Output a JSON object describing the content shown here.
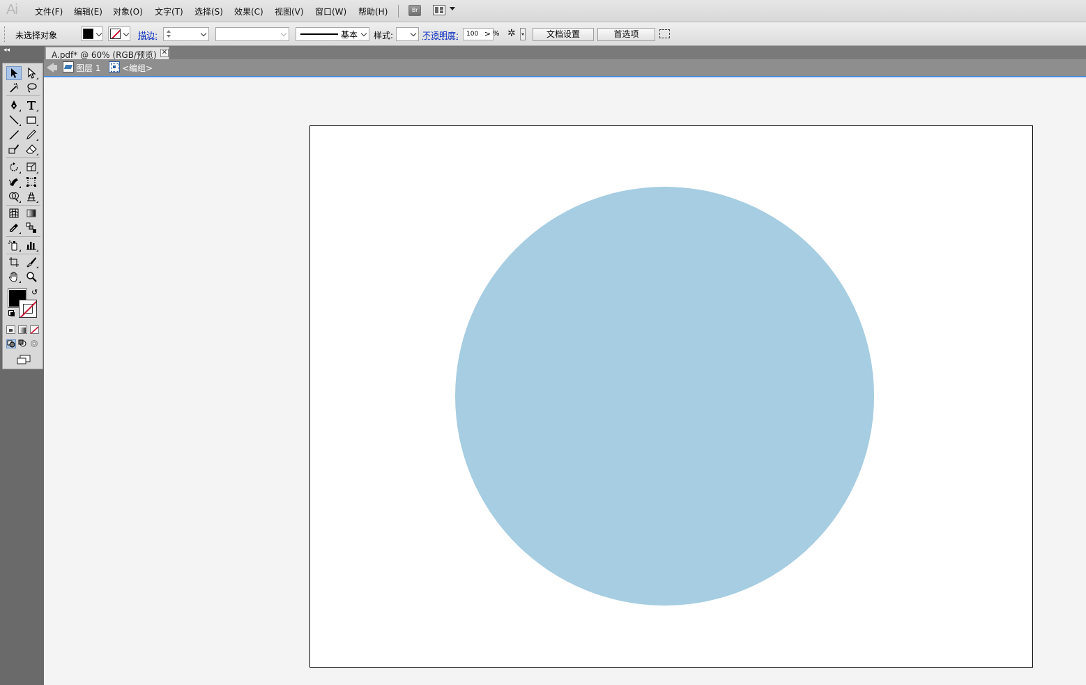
{
  "app": {
    "logo": "Ai"
  },
  "menu": [
    "文件(F)",
    "编辑(E)",
    "对象(O)",
    "文字(T)",
    "选择(S)",
    "效果(C)",
    "视图(V)",
    "窗口(W)",
    "帮助(H)"
  ],
  "menubar": {
    "bridge_label": "Br"
  },
  "control_bar": {
    "selection_status": "未选择对象",
    "stroke_label": "描边:",
    "stroke_weight": "",
    "stroke_profile": "基本",
    "style_label": "样式:",
    "opacity_label": "不透明度:",
    "opacity_value": "100",
    "opacity_arrow": ">",
    "percent": "%",
    "document_setup_button": "文档设置",
    "preferences_button": "首选项"
  },
  "document": {
    "tab_title": "A.pdf* @ 60% (RGB/预览)",
    "close_glyph": "✕",
    "breadcrumb": {
      "layer": "图层 1",
      "group": "<编组>"
    }
  },
  "toolbox": {
    "collapse_glyph": "◂◂",
    "swap_glyph": "↺"
  },
  "colors": {
    "fill": "#000000",
    "circle_fill": "#a6cde1",
    "accent": "#4b8de6"
  },
  "artwork": {
    "shape": "circle"
  }
}
